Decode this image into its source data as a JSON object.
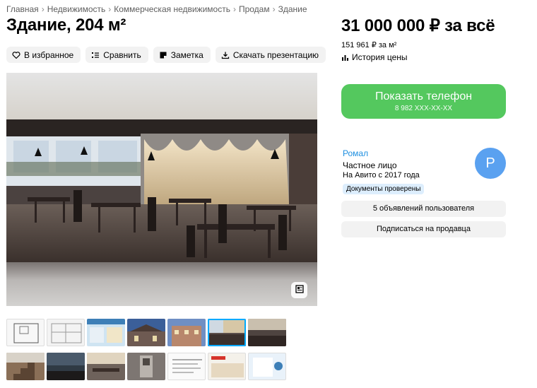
{
  "breadcrumb": {
    "items": [
      "Главная",
      "Недвижимость",
      "Коммерческая недвижимость",
      "Продам",
      "Здание"
    ],
    "separator": "›"
  },
  "listing": {
    "title": "Здание, 204 м²",
    "price": "31 000 000 ₽ за всё",
    "price_per_sqm": "151 961 ₽ за м²",
    "price_history_label": "История цены"
  },
  "actions": {
    "favorite": "В избранное",
    "compare": "Сравнить",
    "note": "Заметка",
    "download": "Скачать презентацию"
  },
  "contact": {
    "show_phone_label": "Показать телефон",
    "phone_masked": "8 982 XXX-XX-XX"
  },
  "seller": {
    "name": "Ромал",
    "type": "Частное лицо",
    "since": "На Авито с 2017 года",
    "badge": "Документы проверены",
    "avatar_letter": "Р",
    "listings_button": "5 объявлений пользователя",
    "subscribe_button": "Подписаться на продавца"
  },
  "gallery": {
    "thumbnails_row1": [
      "floor-plan",
      "drawing",
      "map",
      "building-exterior",
      "building-street",
      "restaurant-interior",
      "hall-interior"
    ],
    "thumbnails_row2": [
      "stairs",
      "dark-hall",
      "dining-room",
      "kitchen",
      "document",
      "advert-poster",
      "document-card"
    ],
    "active_index": 5
  },
  "colors": {
    "accent_green": "#54c85e",
    "link_blue": "#1e8fe0",
    "badge_bg": "#ddeefd",
    "avatar_bg": "#5aa1f0",
    "button_gray": "#f2f2f2"
  }
}
